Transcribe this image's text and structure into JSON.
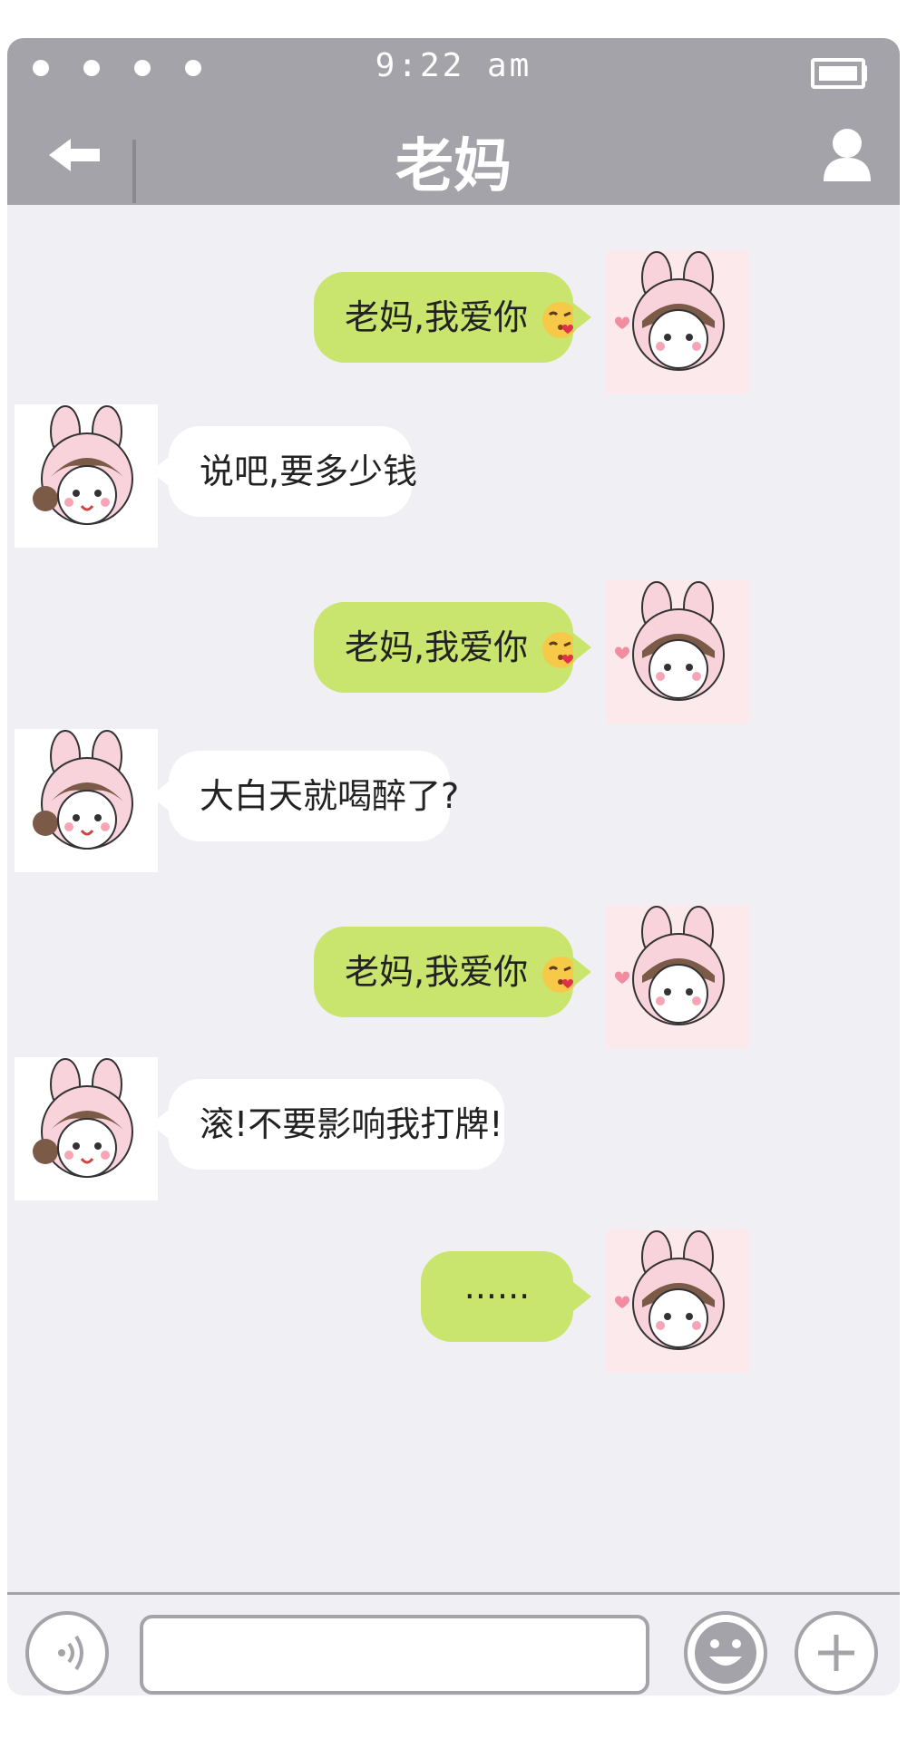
{
  "status_bar": {
    "time": "9:22  am"
  },
  "header": {
    "title": "老妈",
    "back_icon": "back-arrow-icon",
    "profile_icon": "person-icon"
  },
  "messages": [
    {
      "direction": "sent",
      "text": "老妈,我爱你",
      "emoji": "kissing-heart-emoji"
    },
    {
      "direction": "received",
      "text": "说吧,要多少钱"
    },
    {
      "direction": "sent",
      "text": "老妈,我爱你",
      "emoji": "kissing-heart-emoji"
    },
    {
      "direction": "received",
      "text": "大白天就喝醉了?"
    },
    {
      "direction": "sent",
      "text": "老妈,我爱你",
      "emoji": "kissing-heart-emoji"
    },
    {
      "direction": "received",
      "text": "滚!不要影响我打牌!"
    },
    {
      "direction": "sent",
      "text": "······"
    }
  ],
  "input_bar": {
    "text_value": "",
    "voice_icon": "voice-icon",
    "emoji_icon": "smiley-icon",
    "plus_icon": "plus-icon"
  },
  "colors": {
    "header": "#a4a3a9",
    "background": "#f0eff4",
    "sent_bubble": "#c9e56d",
    "received_bubble": "#ffffff"
  }
}
